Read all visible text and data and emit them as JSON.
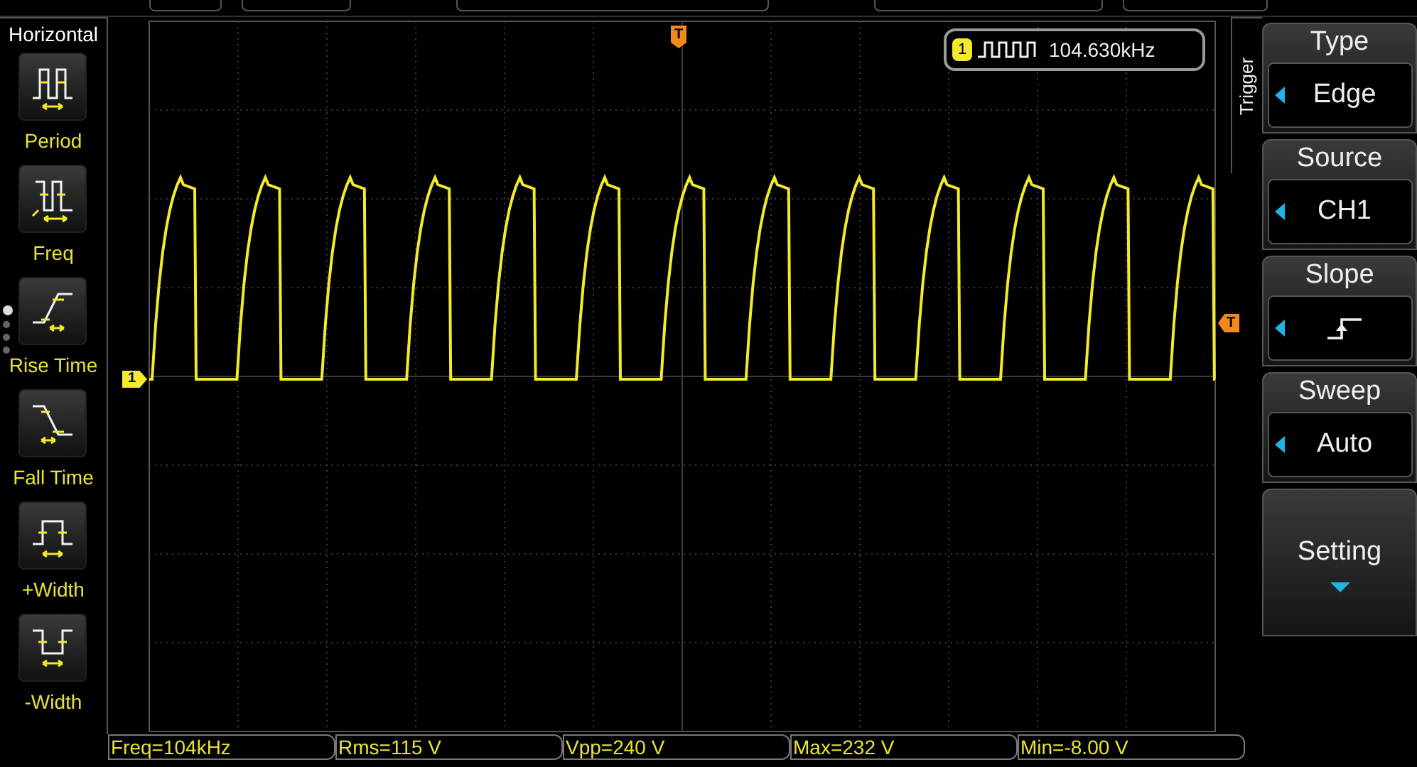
{
  "horizontal_panel": {
    "title": "Horizontal",
    "items": [
      {
        "label": "Period",
        "kind": "period"
      },
      {
        "label": "Freq",
        "kind": "freq"
      },
      {
        "label": "Rise Time",
        "kind": "rise"
      },
      {
        "label": "Fall Time",
        "kind": "fall"
      },
      {
        "label": "+Width",
        "kind": "pwidth"
      },
      {
        "label": "-Width",
        "kind": "nwidth"
      }
    ],
    "page_dots": [
      {
        "selected": true
      },
      {
        "selected": false
      },
      {
        "selected": false
      },
      {
        "selected": false
      }
    ]
  },
  "display": {
    "channel_marker": "1",
    "trigger_position_marker": "T",
    "trigger_level_marker": "T",
    "frequency_counter": {
      "channel": "1",
      "value": "104.630kHz"
    }
  },
  "trigger_menu": {
    "title": "Trigger",
    "items": [
      {
        "kind": "select",
        "label": "Type",
        "value": "Edge"
      },
      {
        "kind": "select",
        "label": "Source",
        "value": "CH1"
      },
      {
        "kind": "slope",
        "label": "Slope",
        "rising": true
      },
      {
        "kind": "select",
        "label": "Sweep",
        "value": "Auto"
      },
      {
        "kind": "submenu",
        "label": "Setting"
      }
    ]
  },
  "measurements": [
    "Freq=104kHz",
    "Rms=115 V",
    "Vpp=240 V",
    "Max=232 V",
    "Min=-8.00 V"
  ]
}
